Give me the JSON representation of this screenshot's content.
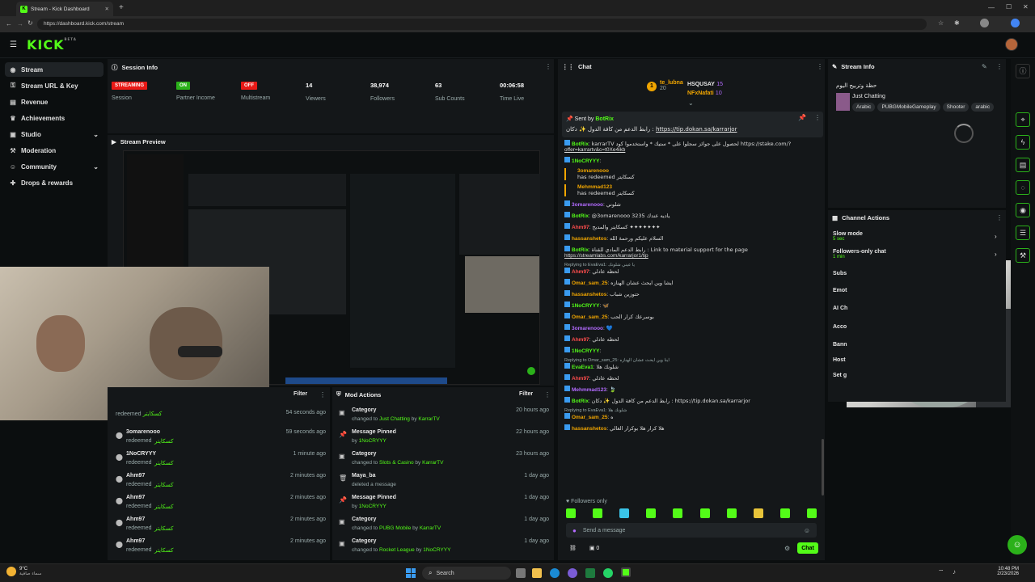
{
  "browser": {
    "tab_title": "Stream - Kick Dashboard",
    "url": "https://dashboard.kick.com/stream",
    "new_tab": "+"
  },
  "brand": {
    "logo": "KICK",
    "beta": "BETA",
    "accent": "#53fc18"
  },
  "sidebar": {
    "items": [
      {
        "label": "Stream",
        "icon": "broadcast-icon"
      },
      {
        "label": "Stream URL & Key",
        "icon": "key-icon"
      },
      {
        "label": "Revenue",
        "icon": "revenue-icon"
      },
      {
        "label": "Achievements",
        "icon": "trophy-icon"
      },
      {
        "label": "Studio",
        "icon": "studio-icon"
      },
      {
        "label": "Moderation",
        "icon": "hammer-icon"
      },
      {
        "label": "Community",
        "icon": "people-icon"
      },
      {
        "label": "Drops & rewards",
        "icon": "gift-icon"
      }
    ]
  },
  "session": {
    "title": "Session Info",
    "stats": [
      {
        "badge": "STREAMING",
        "label": "Session",
        "color": "#e91916"
      },
      {
        "badge": "ON",
        "label": "Partner Income",
        "color": "#2bb11a"
      },
      {
        "badge": "OFF",
        "label": "Multistream",
        "color": "#e91916"
      },
      {
        "value": "14",
        "label": "Viewers"
      },
      {
        "value": "38,974",
        "label": "Followers"
      },
      {
        "value": "63",
        "label": "Sub Counts"
      },
      {
        "value": "00:06:58",
        "label": "Time Live"
      }
    ]
  },
  "preview": {
    "title": "Stream Preview"
  },
  "activity": {
    "filter": "Filter",
    "rows": [
      {
        "user": "",
        "sub": "redeemed",
        "reward": "كسكايتر",
        "time": "54 seconds ago"
      },
      {
        "user": "3omarenooo",
        "sub": "redeemed",
        "reward": "كسكايتر",
        "time": "59 seconds ago"
      },
      {
        "user": "1NoCRYYY",
        "sub": "redeemed",
        "reward": "كسكايتر",
        "time": "1 minute ago"
      },
      {
        "user": "Ahm97",
        "sub": "redeemed",
        "reward": "كسكايتر",
        "time": "2 minutes ago"
      },
      {
        "user": "Ahm97",
        "sub": "redeemed",
        "reward": "كسكايتر",
        "time": "2 minutes ago"
      },
      {
        "user": "Ahm97",
        "sub": "redeemed",
        "reward": "كسكايتر",
        "time": "2 minutes ago"
      },
      {
        "user": "Ahm97",
        "sub": "redeemed",
        "reward": "كسكايتر",
        "time": "2 minutes ago"
      }
    ]
  },
  "mod": {
    "title": "Mod Actions",
    "filter": "Filter",
    "rows": [
      {
        "icon": "category-icon",
        "title": "Category",
        "pre": "changed to ",
        "value": "Just Chatting",
        "mid": " by ",
        "by": "KarrarTV",
        "time": "20 hours ago"
      },
      {
        "icon": "pin-icon",
        "title": "Message Pinned",
        "pre": "by ",
        "value": "",
        "mid": "",
        "by": "1NoCRYYY",
        "time": "22 hours ago"
      },
      {
        "icon": "category-icon",
        "title": "Category",
        "pre": "changed to ",
        "value": "Slots & Casino",
        "mid": " by ",
        "by": "KarrarTV",
        "time": "23 hours ago"
      },
      {
        "icon": "trash-icon",
        "title": "Maya_ba",
        "pre": "deleted a message",
        "value": "",
        "mid": "",
        "by": "",
        "time": "1 day ago"
      },
      {
        "icon": "pin-icon",
        "title": "Message Pinned",
        "pre": "by ",
        "value": "",
        "mid": "",
        "by": "1NoCRYYY",
        "time": "1 day ago"
      },
      {
        "icon": "category-icon",
        "title": "Category",
        "pre": "changed to ",
        "value": "PUBG Mobile",
        "mid": " by ",
        "by": "KarrarTV",
        "time": "1 day ago"
      },
      {
        "icon": "category-icon",
        "title": "Category",
        "pre": "changed to ",
        "value": "Rocket League",
        "mid": " by ",
        "by": "1NoCRYYY",
        "time": "1 day ago"
      }
    ]
  },
  "chat": {
    "title": "Chat",
    "leaders": [
      {
        "rank": "1",
        "name": "te_lubna",
        "count": "20"
      },
      {
        "rank": "",
        "name": "HSQUSAY",
        "count": "15"
      },
      {
        "rank": "",
        "name": "NFxNafati",
        "count": "10"
      }
    ],
    "pinned": {
      "by_label": "Sent by",
      "by": "BotRix",
      "text": "رابط الدعم من كافة الدول ✨ دكان :",
      "link": "https://tip.dokan.sa/karrarjor"
    },
    "lines": [
      {
        "user": "BotRix",
        "color": "#53fc18",
        "text": "karrarTV لحصول على جوائز سجلوا على * ستيك * واستخدموا كود https://stake.com/?",
        "text2": "offer=karrartv&c=t0Xe4ikb"
      },
      {
        "user": "1NoCRYYY",
        "color": "#53fc18",
        "text": ""
      },
      {
        "user": "3omarenooo",
        "color": "#f0a500",
        "text": "has redeemed كسكايتر",
        "redeem": true
      },
      {
        "user": "Mehmmad123",
        "color": "#f0a500",
        "text": "has redeemed كسكايتر",
        "redeem": true
      },
      {
        "user": "3omarenooo",
        "color": "#b36bff",
        "text": "شلوني"
      },
      {
        "user": "BotRix",
        "color": "#53fc18",
        "text": "@3omarenooo 3235 ياديه عندك"
      },
      {
        "user": "Ahm97",
        "color": "#ff4d4d",
        "text": "كسكايتر والمديح ✦✦✦✦✦✦✦"
      },
      {
        "user": "hassanshetos",
        "color": "#f0a500",
        "text": "السلام عليكم ورحمة الله"
      },
      {
        "user": "BotRix",
        "color": "#53fc18",
        "text": "رابط الدعم المادي للقناة : Link to material support for the page",
        "text2": "https://streamlabs.com/karrarjor1/tip"
      },
      {
        "user": "Ahm97",
        "color": "#ff4d4d",
        "text": "لحظه عادلي",
        "reply": "Replying to EvaEva1: يا عيني شلونك"
      },
      {
        "user": "Omar_sam_25",
        "color": "#f0a500",
        "text": "ايشا وين ايحث عشان الهنازه"
      },
      {
        "user": "hassanshetos",
        "color": "#f0a500",
        "text": "حتوزين شباب"
      },
      {
        "user": "1NoCRYYY",
        "color": "#53fc18",
        "text": "🦋"
      },
      {
        "user": "Omar_sam_25",
        "color": "#f0a500",
        "text": "بوسرعك كرار الحب"
      },
      {
        "user": "3omarenooo",
        "color": "#b36bff",
        "text": "💙"
      },
      {
        "user": "Ahm97",
        "color": "#ff4d4d",
        "text": "لحظه عادلي"
      },
      {
        "user": "1NoCRYYY",
        "color": "#53fc18",
        "text": ""
      },
      {
        "user": "EvaEva1",
        "color": "#53fc18",
        "text": "شلونك هلا",
        "reply": "Replying to Omar_sam_25: اينا وين ايحث عشان الهنازه"
      },
      {
        "user": "Ahm97",
        "color": "#ff4d4d",
        "text": "لحظه عادلي"
      },
      {
        "user": "Mehmmad123",
        "color": "#b36bff",
        "text": "🍃"
      },
      {
        "user": "BotRix",
        "color": "#53fc18",
        "text": "رابط الدعم من كافة الدول ✨ دكان : https://tip.dokan.sa/karrarjor"
      },
      {
        "user": "Omar_sam_25",
        "color": "#f0a500",
        "text": "ه",
        "reply": "Replying to EvaEva1: شلونك هلا"
      },
      {
        "user": "hassanshetos",
        "color": "#f0a500",
        "text": "هلا كرار هلا بوكرار الغالي"
      }
    ],
    "followers_only": "Followers only",
    "placeholder": "Send a message",
    "count": "0",
    "send": "Chat"
  },
  "stream_info": {
    "title": "Stream Info",
    "stream_title": "حظة وتربيح اليوم",
    "category": "Just Chatting",
    "tags": [
      "Arabic",
      "PUBGMobileGameplay",
      "Shooter",
      "arabic"
    ]
  },
  "channel_actions": {
    "title": "Channel Actions",
    "items": [
      {
        "label": "Slow mode",
        "value": "5 sec"
      },
      {
        "label": "Followers-only chat",
        "value": "1 min"
      },
      {
        "label": "Subs",
        "value": ""
      },
      {
        "label": "Emot",
        "value": ""
      },
      {
        "label": "AI Ch",
        "value": ""
      },
      {
        "label": "Acco",
        "value": ""
      },
      {
        "label": "Bann",
        "value": ""
      },
      {
        "label": "Host",
        "value": ""
      },
      {
        "label": "Set g",
        "value": ""
      }
    ]
  },
  "taskbar": {
    "weather": "9°C",
    "weather_sub": "سماء صافية",
    "search": "Search",
    "time": "10:48 PM",
    "date": "2/23/2026"
  }
}
